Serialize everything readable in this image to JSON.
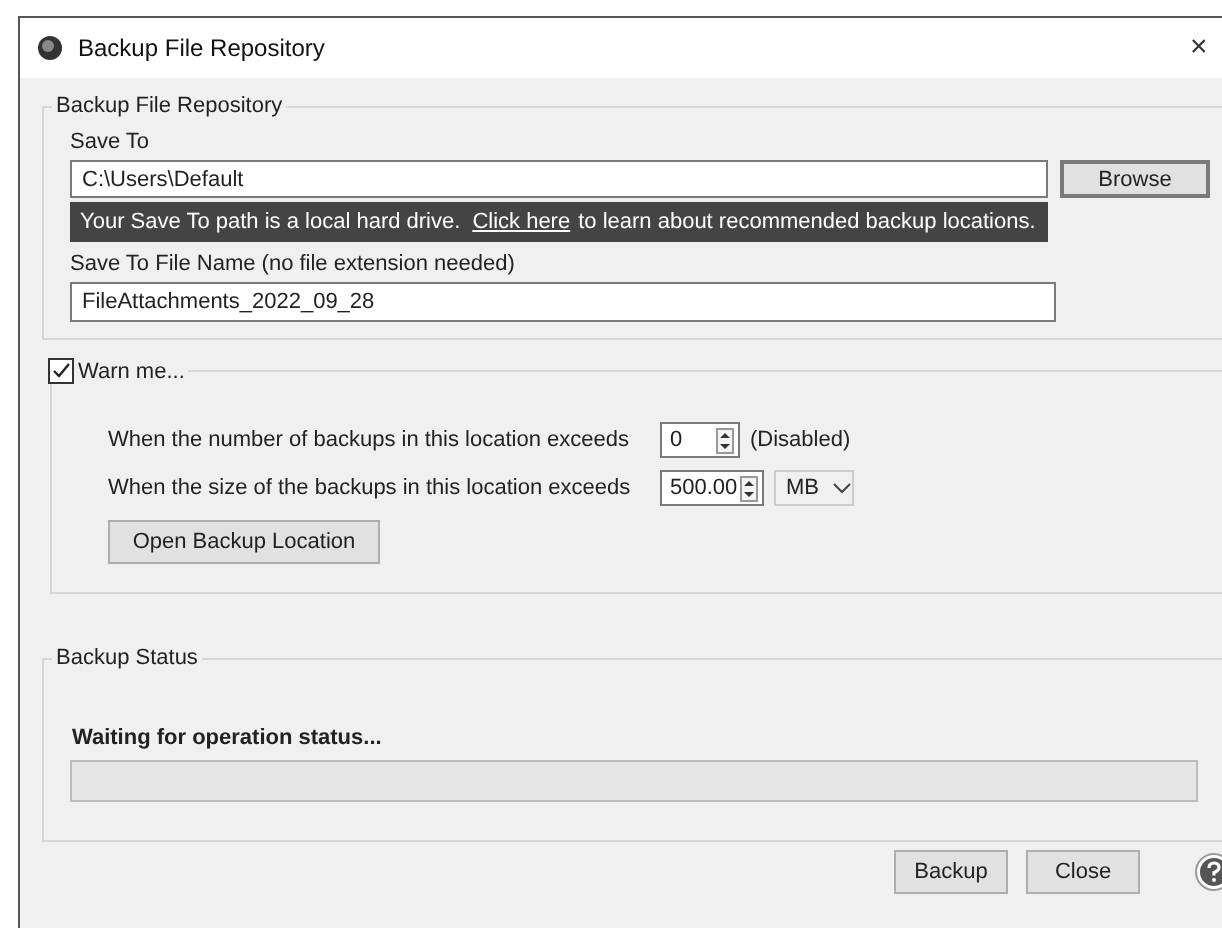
{
  "window": {
    "title": "Backup File Repository",
    "close": "×"
  },
  "repository": {
    "legend": "Backup File Repository",
    "save_to_label": "Save To",
    "save_to_value": "C:\\Users\\Default",
    "browse": "Browse",
    "notice_before": "Your Save To path is a local hard drive.",
    "notice_link": "Click here",
    "notice_after": "to learn about recommended backup locations.",
    "file_name_label": "Save To File Name (no file extension needed)",
    "file_name_value": "FileAttachments_2022_09_28"
  },
  "warn": {
    "label": "Warn me...",
    "checked": true,
    "rows": [
      {
        "label": "When the number of backups in this location exceeds",
        "value": "0",
        "note": "(Disabled)"
      },
      {
        "label": "When the size of the backups in this location exceeds",
        "value": "500.00",
        "unit": "MB"
      }
    ],
    "open_button": "Open Backup Location"
  },
  "status": {
    "legend": "Backup Status",
    "message": "Waiting for operation status..."
  },
  "buttons": [
    "Backup",
    "Close"
  ]
}
